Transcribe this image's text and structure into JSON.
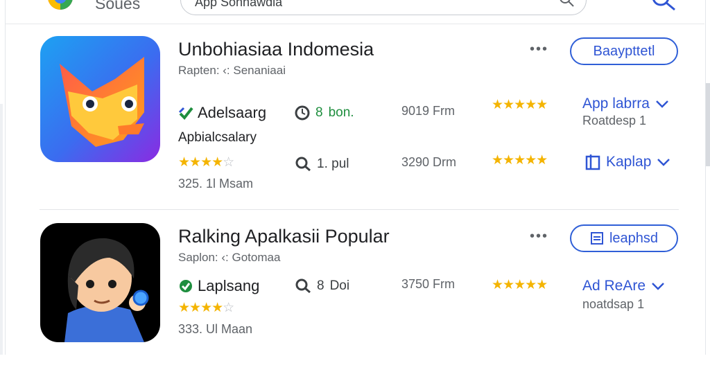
{
  "header": {
    "store_name": "Soues",
    "search_value": "App Sonnawdia"
  },
  "apps": [
    {
      "title": "Unbohiasiaa Indomesia",
      "subtitle": "Rapten: ‹: Senaniaai",
      "action_label": "Baaypttetl",
      "developer": "Adelsaarg",
      "category": "Apbialcsalary",
      "downloads": "325. 1l Msam",
      "stat1": {
        "prefix": "8",
        "label": "bon."
      },
      "stat2": {
        "label": "1. pul"
      },
      "size1": "9019 Frm",
      "size2": "3290 Drm",
      "link1": {
        "label": "App labrra",
        "sub": "Roatdesp 1"
      },
      "link2": {
        "label": "Kaplap"
      },
      "rating_main": "4.5"
    },
    {
      "title": "Ralking Apalkasii Popular",
      "subtitle": "Saplon: ‹: Gotomaa",
      "action_label": "leaphsd",
      "developer": "Laplsang",
      "downloads": "333. Ul Maan",
      "stat1": {
        "prefix": "8",
        "label": "Doi"
      },
      "size1": "3750 Frm",
      "link1": {
        "label": "Ad ReAre",
        "sub": "noatdsap 1"
      },
      "rating_main": "4.5"
    }
  ],
  "colors": {
    "accent": "#2f55d4",
    "star": "#f4b400",
    "green": "#1e8e3e"
  },
  "icons": {
    "more": "more-dots-icon",
    "search": "search-icon",
    "chevron": "chevron-down-icon"
  }
}
